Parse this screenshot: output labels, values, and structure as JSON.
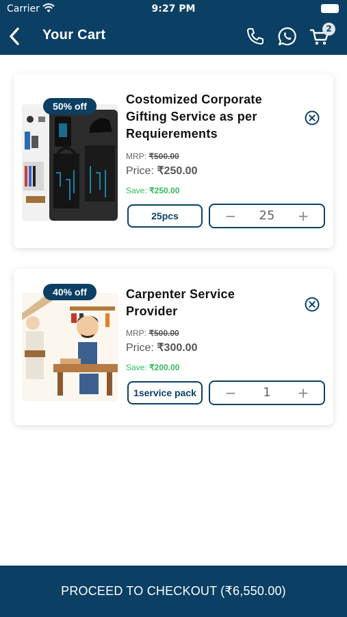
{
  "status_bar": {
    "carrier": "Carrier",
    "time": "9:27 PM"
  },
  "header": {
    "title": "Your Cart",
    "cart_count": "2"
  },
  "cart_items": [
    {
      "discount": "50% off",
      "name": "Costomized Corporate Gifting Service as per Requierements",
      "mrp_label": "MRP:",
      "mrp_value": "₹500.00",
      "price_label": "Price:",
      "price_value": "₹250.00",
      "save_label": "Save:",
      "save_value": "₹250.00",
      "unit": "25pcs",
      "quantity": "25"
    },
    {
      "discount": "40% off",
      "name": "Carpenter Service Provider",
      "mrp_label": "MRP:",
      "mrp_value": "₹500.00",
      "price_label": "Price:",
      "price_value": "₹300.00",
      "save_label": "Save:",
      "save_value": "₹200.00",
      "unit": "1service pack",
      "quantity": "1"
    }
  ],
  "stepper_symbols": {
    "minus": "−",
    "plus": "+"
  },
  "checkout": {
    "label": "PROCEED TO CHECKOUT (₹6,550.00)"
  },
  "colors": {
    "brand": "#0b3f63",
    "save_green": "#2ebd59"
  },
  "icons": [
    "back-arrow-icon",
    "phone-icon",
    "whatsapp-icon",
    "cart-icon",
    "remove-circle-icon",
    "wifi-icon",
    "battery-icon"
  ]
}
